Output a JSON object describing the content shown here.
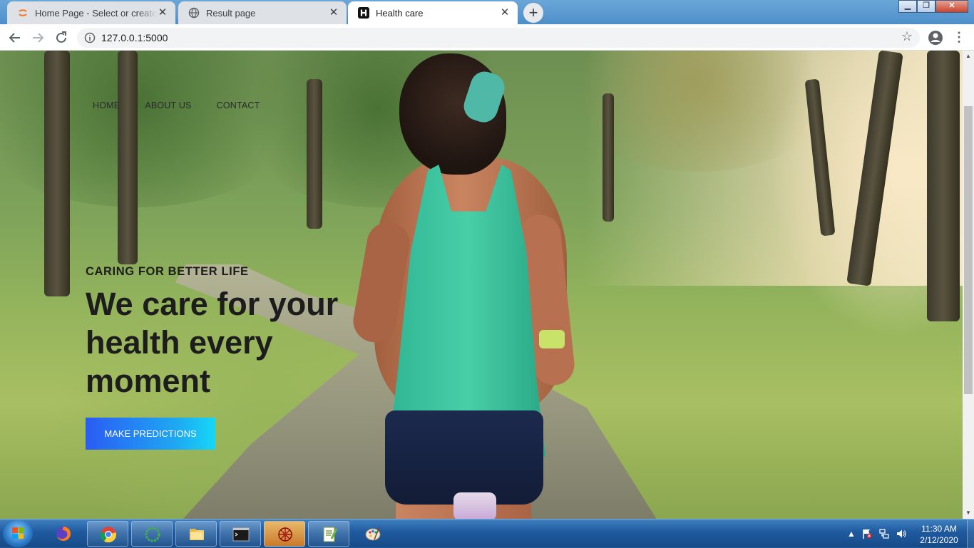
{
  "browser": {
    "tabs": [
      {
        "title": "Home Page - Select or create a n",
        "favicon": "jupyter-icon",
        "active": false
      },
      {
        "title": "Result page",
        "favicon": "globe-icon",
        "active": false
      },
      {
        "title": "Health care",
        "favicon": "h-letter-icon",
        "active": true
      }
    ],
    "new_tab_label": "+",
    "close_glyph": "✕",
    "address": "127.0.0.1:5000",
    "window_controls": {
      "minimize": "▁",
      "maximize": "❐",
      "close": "✕"
    }
  },
  "page": {
    "nav": [
      {
        "label": "HOME"
      },
      {
        "label": "ABOUT US"
      },
      {
        "label": "CONTACT"
      }
    ],
    "tagline": "CARING FOR BETTER LIFE",
    "headline": "We care for your health every moment",
    "cta_label": "MAKE PREDICTIONS"
  },
  "taskbar": {
    "apps": [
      "firefox-icon",
      "chrome-icon",
      "anaconda-icon",
      "file-explorer-icon",
      "command-prompt-icon",
      "spider-icon",
      "notepad-plus-plus-icon",
      "paint-icon"
    ],
    "clock_time": "11:30 AM",
    "clock_date": "2/12/2020"
  },
  "colors": {
    "cta_gradient_start": "#2a5cf4",
    "cta_gradient_end": "#16d8f6",
    "heading_text": "#1d1d1d"
  }
}
